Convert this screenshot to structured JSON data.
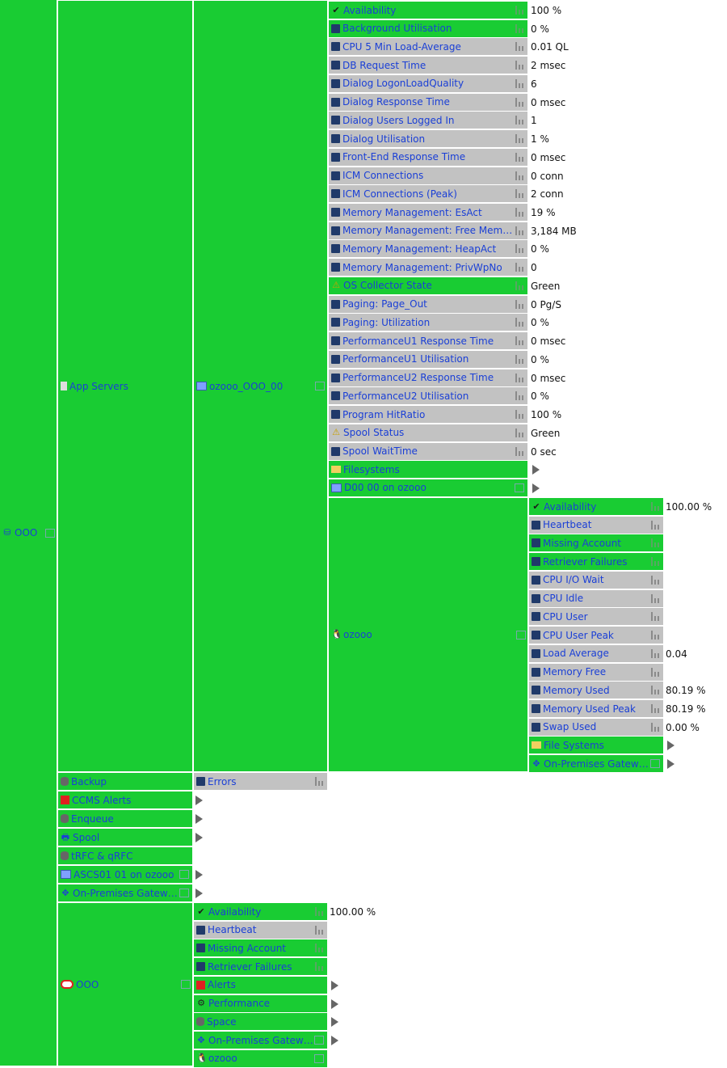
{
  "root": {
    "label": "OOO",
    "icon": "sap-system-icon"
  },
  "level1": [
    {
      "label": "App Servers",
      "icon": "document-icon"
    },
    {
      "label": "Backup",
      "icon": "database-icon"
    },
    {
      "label": "CCMS Alerts",
      "icon": "alert-icon"
    },
    {
      "label": "Enqueue",
      "icon": "database-icon"
    },
    {
      "label": "Spool",
      "icon": "printer-icon"
    },
    {
      "label": "tRFC & qRFC",
      "icon": "database-icon"
    },
    {
      "label": "ASCS01 01 on ozooo",
      "icon": "server-icon"
    },
    {
      "label": "On-Premises Gateway",
      "icon": "network-icon"
    },
    {
      "label": "OOO",
      "icon": "oracle-icon"
    }
  ],
  "app_server": {
    "label": "ozooo_OOO_00",
    "icon": "server-icon"
  },
  "backup_child": {
    "label": "Errors"
  },
  "metrics": [
    {
      "label": "Availability",
      "value": "100 %"
    },
    {
      "label": "Background Utilisation",
      "value": "0 %"
    },
    {
      "label": "CPU 5 Min Load-Average",
      "value": "0.01 QL"
    },
    {
      "label": "DB Request Time",
      "value": "2 msec"
    },
    {
      "label": "Dialog LogonLoadQuality",
      "value": "6"
    },
    {
      "label": "Dialog Response Time",
      "value": "0 msec"
    },
    {
      "label": "Dialog Users Logged In",
      "value": "1"
    },
    {
      "label": "Dialog Utilisation",
      "value": "1 %"
    },
    {
      "label": "Front-End Response Time",
      "value": "0 msec"
    },
    {
      "label": "ICM Connections",
      "value": "0 conn"
    },
    {
      "label": "ICM Connections (Peak)",
      "value": "2 conn"
    },
    {
      "label": "Memory Management: EsAct",
      "value": "19 %"
    },
    {
      "label": "Memory Management: Free Memory",
      "value": "3,184 MB"
    },
    {
      "label": "Memory Management: HeapAct",
      "value": "0 %"
    },
    {
      "label": "Memory Management: PrivWpNo",
      "value": "0"
    },
    {
      "label": "OS Collector State",
      "value": "Green"
    },
    {
      "label": "Paging: Page_Out",
      "value": "0 Pg/S"
    },
    {
      "label": "Paging: Utilization",
      "value": "0 %"
    },
    {
      "label": "PerformanceU1 Response Time",
      "value": "0 msec"
    },
    {
      "label": "PerformanceU1 Utilisation",
      "value": "0 %"
    },
    {
      "label": "PerformanceU2 Response Time",
      "value": "0 msec"
    },
    {
      "label": "PerformanceU2 Utilisation",
      "value": "0 %"
    },
    {
      "label": "Program HitRatio",
      "value": "100 %"
    },
    {
      "label": "Spool Status",
      "value": "Green"
    },
    {
      "label": "Spool WaitTime",
      "value": "0 sec"
    },
    {
      "label": "Filesystems",
      "value": ""
    },
    {
      "label": "D00 00 on ozooo",
      "value": ""
    }
  ],
  "host": {
    "label": "ozooo"
  },
  "host_metrics": [
    {
      "label": "Availability",
      "value": "100.00 %"
    },
    {
      "label": "Heartbeat",
      "value": ""
    },
    {
      "label": "Missing Account",
      "value": ""
    },
    {
      "label": "Retriever Failures",
      "value": ""
    },
    {
      "label": "CPU I/O Wait",
      "value": ""
    },
    {
      "label": "CPU Idle",
      "value": ""
    },
    {
      "label": "CPU User",
      "value": ""
    },
    {
      "label": "CPU User Peak",
      "value": ""
    },
    {
      "label": "Load Average",
      "value": "0.04"
    },
    {
      "label": "Memory Free",
      "value": ""
    },
    {
      "label": "Memory Used",
      "value": "80.19 %"
    },
    {
      "label": "Memory Used Peak",
      "value": "80.19 %"
    },
    {
      "label": "Swap Used",
      "value": "0.00 %"
    },
    {
      "label": "File Systems",
      "value": ""
    },
    {
      "label": "On-Premises Gateway",
      "value": ""
    }
  ],
  "oracle_children": [
    {
      "label": "Availability",
      "value": "100.00 %"
    },
    {
      "label": "Heartbeat",
      "value": ""
    },
    {
      "label": "Missing Account",
      "value": ""
    },
    {
      "label": "Retriever Failures",
      "value": ""
    },
    {
      "label": "Alerts",
      "value": ""
    },
    {
      "label": "Performance",
      "value": ""
    },
    {
      "label": "Space",
      "value": ""
    },
    {
      "label": "On-Premises Gateway",
      "value": ""
    },
    {
      "label": "ozooo",
      "value": ""
    }
  ]
}
